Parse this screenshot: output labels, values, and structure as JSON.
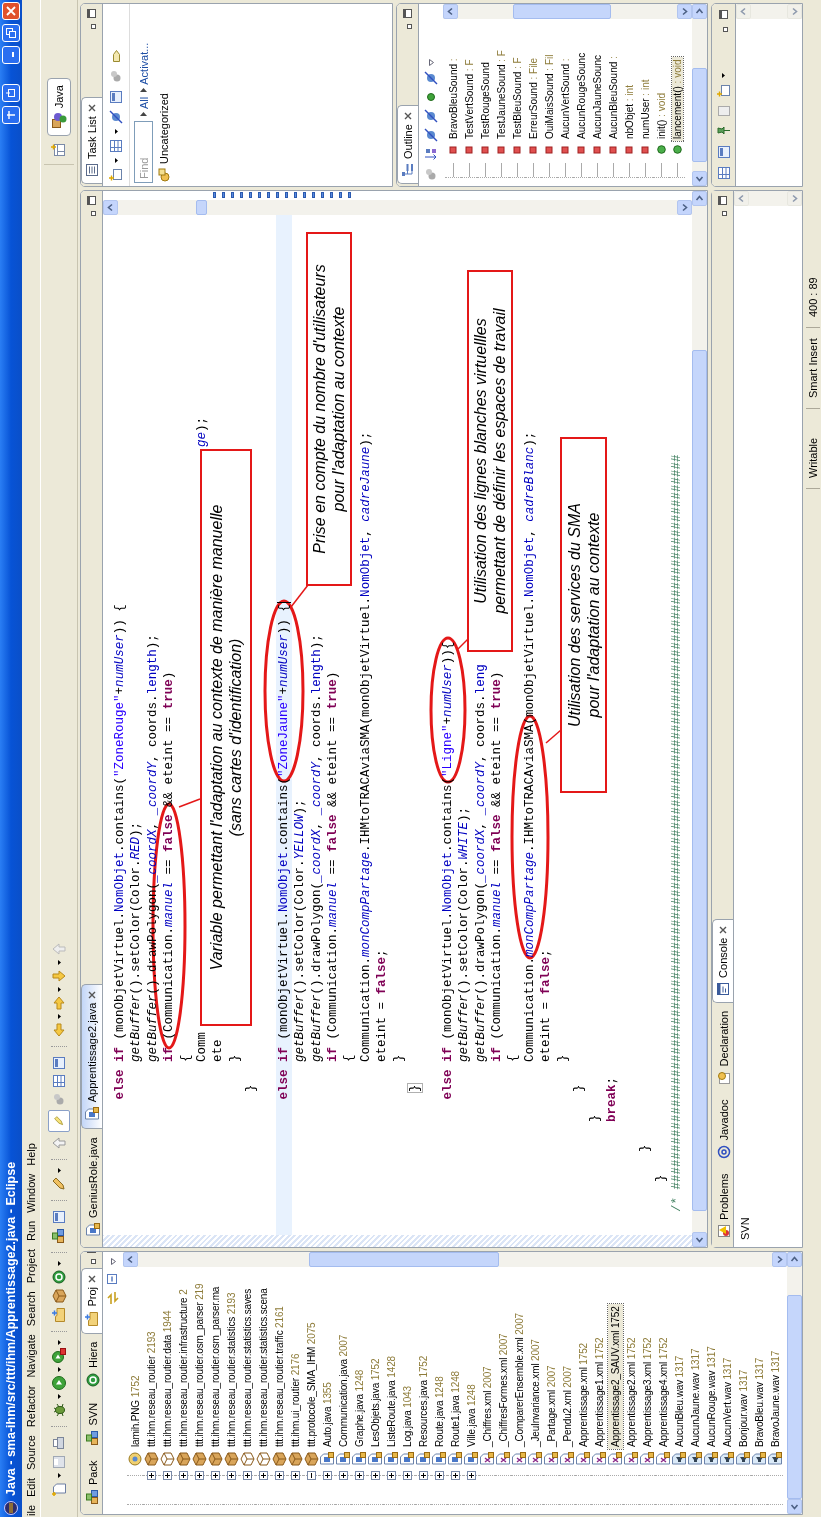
{
  "window": {
    "title": "Java - sma-ihm/src/ttt/ihm/Apprentissage2.java - Eclipse"
  },
  "menu": [
    "ile",
    "Edit",
    "Source",
    "Refactor",
    "Navigate",
    "Search",
    "Project",
    "Run",
    "Window",
    "Help"
  ],
  "perspective": {
    "label": "Java",
    "selected": true
  },
  "explorer": {
    "tabs": [
      {
        "label": "Pack",
        "selected": false
      },
      {
        "label": "SVN",
        "selected": false
      },
      {
        "label": "Hiera",
        "selected": false
      },
      {
        "label": "Proj",
        "selected": true
      }
    ],
    "items": [
      {
        "kind": "image",
        "name": "lamih.PNG",
        "rev": "1752",
        "selected": false
      },
      {
        "kind": "package",
        "name": "ttt.ihm.reseau_routier",
        "rev": "2193",
        "expanded": false,
        "selected": false
      },
      {
        "kind": "empty-package",
        "name": "ttt.ihm.reseau_routier.data",
        "rev": "1944",
        "expanded": false,
        "selected": false
      },
      {
        "kind": "package",
        "name": "ttt.ihm.reseau_routier.infrastructure",
        "rev": "2",
        "expanded": false,
        "selected": false
      },
      {
        "kind": "package",
        "name": "ttt.ihm.reseau_routier.osm_parser",
        "rev": "219",
        "expanded": false,
        "selected": false
      },
      {
        "kind": "package",
        "name": "ttt.ihm.reseau_routier.osm_parser.ma",
        "expanded": false,
        "selected": false
      },
      {
        "kind": "package",
        "name": "ttt.ihm.reseau_routier.statistics",
        "rev": "2193",
        "expanded": false,
        "selected": false
      },
      {
        "kind": "empty-package",
        "name": "ttt.ihm.reseau_routier.statistics.saves",
        "expanded": false,
        "selected": false
      },
      {
        "kind": "empty-package",
        "name": "ttt.ihm.reseau_routier.statistics.scena",
        "expanded": false,
        "selected": false
      },
      {
        "kind": "package",
        "name": "ttt.ihm.reseau_routier.traffic",
        "rev": "2161",
        "expanded": false,
        "selected": false
      },
      {
        "kind": "package",
        "name": "ttt.ihm.ui_routier",
        "rev": "2176",
        "expanded": false,
        "selected": false
      },
      {
        "kind": "package",
        "name": "ttt.protocole_SMA_IHM",
        "rev": "2075",
        "expanded": true,
        "selected": false
      },
      {
        "kind": "java",
        "name": "Auto.java",
        "rev": "1355",
        "expanded": false,
        "selected": false
      },
      {
        "kind": "java",
        "name": "Communication.java",
        "rev": "2007",
        "expanded": false,
        "selected": false
      },
      {
        "kind": "java",
        "name": "Graphe.java",
        "rev": "1248",
        "expanded": false,
        "selected": false
      },
      {
        "kind": "java",
        "name": "LesObjets.java",
        "rev": "1752",
        "expanded": false,
        "selected": false
      },
      {
        "kind": "java",
        "name": "ListeRoute.java",
        "rev": "1428",
        "expanded": false,
        "selected": false
      },
      {
        "kind": "java",
        "name": "Log.java",
        "rev": "1043",
        "expanded": false,
        "selected": false
      },
      {
        "kind": "java",
        "name": "Resources.java",
        "rev": "1752",
        "expanded": false,
        "selected": false
      },
      {
        "kind": "java",
        "name": "Route.java",
        "rev": "1248",
        "expanded": false,
        "selected": false
      },
      {
        "kind": "java",
        "name": "Route1.java",
        "rev": "1248",
        "expanded": false,
        "selected": false
      },
      {
        "kind": "java",
        "name": "Ville.java",
        "rev": "1248",
        "expanded": false,
        "selected": false
      },
      {
        "kind": "xml",
        "name": "_Chiffres.xml",
        "rev": "2007",
        "selected": false
      },
      {
        "kind": "xml",
        "name": "_ChiffresFormes.xml",
        "rev": "2007",
        "selected": false
      },
      {
        "kind": "xml",
        "name": "_ComparerEnsemble.xml",
        "rev": "2007",
        "selected": false
      },
      {
        "kind": "xml",
        "name": "_JeuInvariance.xml",
        "rev": "2007",
        "selected": false
      },
      {
        "kind": "xml",
        "name": "_Partage.xml",
        "rev": "2007",
        "selected": false
      },
      {
        "kind": "xml",
        "name": "_Pendu2.xml",
        "rev": "2007",
        "selected": false
      },
      {
        "kind": "xml",
        "name": "Apprentissage.xml",
        "rev": "1752",
        "selected": false
      },
      {
        "kind": "xml",
        "name": "Apprentissage1.xml",
        "rev": "1752",
        "selected": false
      },
      {
        "kind": "xml",
        "name": "Apprentissage2_SAUV.xml",
        "rev": "1752",
        "selected": true
      },
      {
        "kind": "xml",
        "name": "Apprentissage2.xml",
        "rev": "1752",
        "selected": false
      },
      {
        "kind": "xml",
        "name": "Apprentissage3.xml",
        "rev": "1752",
        "selected": false
      },
      {
        "kind": "xml",
        "name": "Apprentissage4.xml",
        "rev": "1752",
        "selected": false
      },
      {
        "kind": "audio",
        "name": "AucunBleu.wav",
        "rev": "1317",
        "selected": false
      },
      {
        "kind": "audio",
        "name": "AucunJaune.wav",
        "rev": "1317",
        "selected": false
      },
      {
        "kind": "audio",
        "name": "AucunRouge.wav",
        "rev": "1317",
        "selected": false
      },
      {
        "kind": "audio",
        "name": "AucunVert.wav",
        "rev": "1317",
        "selected": false
      },
      {
        "kind": "audio",
        "name": "Bonjour.wav",
        "rev": "1317",
        "selected": false
      },
      {
        "kind": "audio",
        "name": "BravoBleu.wav",
        "rev": "1317",
        "selected": false
      },
      {
        "kind": "audio",
        "name": "BravoJaune.wav",
        "rev": "1317",
        "selected": false
      }
    ]
  },
  "editor": {
    "tabs": [
      {
        "label": "GeniusRole.java",
        "selected": false
      },
      {
        "label": "Apprentissage2.java",
        "selected": true
      }
    ],
    "lines": [
      {
        "kind": "code",
        "current": false,
        "tokens": [
          {
            "kind": "keyword",
            "text": "                 else if"
          },
          {
            "kind": "plain",
            "text": " (monObjetVirtuel."
          },
          {
            "kind": "field",
            "text": "NomObjet"
          },
          {
            "kind": "plain",
            "text": ".contains("
          },
          {
            "kind": "string",
            "text": "\"ZoneRouge\""
          },
          {
            "kind": "plain",
            "text": "+"
          },
          {
            "kind": "static",
            "text": "numUser"
          },
          {
            "kind": "plain",
            "text": ")) {"
          }
        ]
      },
      {
        "kind": "code",
        "current": false,
        "tokens": [
          {
            "kind": "method",
            "text": "                      getBuffer"
          },
          {
            "kind": "plain",
            "text": "().setColor(Color."
          },
          {
            "kind": "static",
            "text": "RED"
          },
          {
            "kind": "plain",
            "text": ");"
          }
        ]
      },
      {
        "kind": "code",
        "current": false,
        "tokens": [
          {
            "kind": "method",
            "text": "                      getBuffer"
          },
          {
            "kind": "plain",
            "text": "().drawPolygon("
          },
          {
            "kind": "static",
            "text": "_coordX"
          },
          {
            "kind": "plain",
            "text": ", "
          },
          {
            "kind": "static",
            "text": "_coordY"
          },
          {
            "kind": "plain",
            "text": ", coords."
          },
          {
            "kind": "field",
            "text": "length"
          },
          {
            "kind": "plain",
            "text": ");"
          }
        ]
      },
      {
        "kind": "code",
        "current": false,
        "tokens": [
          {
            "kind": "keyword",
            "text": "                      if"
          },
          {
            "kind": "plain",
            "text": " (Communication."
          },
          {
            "kind": "static",
            "text": "manuel"
          },
          {
            "kind": "plain",
            "text": " == "
          },
          {
            "kind": "keyword",
            "text": "false"
          },
          {
            "kind": "plain",
            "text": " && eteint == "
          },
          {
            "kind": "keyword",
            "text": "true"
          },
          {
            "kind": "plain",
            "text": ")"
          }
        ]
      },
      {
        "kind": "code",
        "current": false,
        "tokens": [
          {
            "kind": "plain",
            "text": "                      {"
          }
        ]
      },
      {
        "kind": "code",
        "current": false,
        "tokens": [
          {
            "kind": "plain",
            "text": "                      Comm"
          }
        ],
        "after_cover": [
          {
            "kind": "static",
            "text": "ge"
          },
          {
            "kind": "plain",
            "text": ");"
          }
        ]
      },
      {
        "kind": "code",
        "current": false,
        "tokens": [
          {
            "kind": "plain",
            "text": "                      ete"
          }
        ]
      },
      {
        "kind": "code",
        "current": false,
        "tokens": [
          {
            "kind": "plain",
            "text": "                      }"
          }
        ]
      },
      {
        "kind": "code",
        "current": false,
        "tokens": [
          {
            "kind": "plain",
            "text": "                  }"
          }
        ]
      },
      {
        "kind": "blank",
        "current": false
      },
      {
        "kind": "code",
        "current": true,
        "tokens": [
          {
            "kind": "keyword",
            "text": "                 else if"
          },
          {
            "kind": "plain",
            "text": " (monObjetVirtuel."
          },
          {
            "kind": "field",
            "text": "NomObjet"
          },
          {
            "kind": "plain",
            "text": ".contains("
          },
          {
            "kind": "string",
            "text": "\"ZoneJaune\""
          },
          {
            "kind": "plain",
            "text": "+"
          },
          {
            "kind": "static",
            "text": "numUser"
          },
          {
            "kind": "plain",
            "text": ")) {"
          }
        ]
      },
      {
        "kind": "code",
        "current": false,
        "tokens": [
          {
            "kind": "method",
            "text": "                      getBuffer"
          },
          {
            "kind": "plain",
            "text": "().setColor(Color."
          },
          {
            "kind": "static",
            "text": "YELLOW"
          },
          {
            "kind": "plain",
            "text": ");"
          }
        ]
      },
      {
        "kind": "code",
        "current": false,
        "tokens": [
          {
            "kind": "method",
            "text": "                      getBuffer"
          },
          {
            "kind": "plain",
            "text": "().drawPolygon("
          },
          {
            "kind": "static",
            "text": "_coordX"
          },
          {
            "kind": "plain",
            "text": ", "
          },
          {
            "kind": "static",
            "text": "_coordY"
          },
          {
            "kind": "plain",
            "text": ", coords."
          },
          {
            "kind": "field",
            "text": "length"
          },
          {
            "kind": "plain",
            "text": ");"
          }
        ]
      },
      {
        "kind": "code",
        "current": false,
        "tokens": [
          {
            "kind": "keyword",
            "text": "                      if"
          },
          {
            "kind": "plain",
            "text": " (Communication."
          },
          {
            "kind": "static",
            "text": "manuel"
          },
          {
            "kind": "plain",
            "text": " == "
          },
          {
            "kind": "keyword",
            "text": "false"
          },
          {
            "kind": "plain",
            "text": " && eteint == "
          },
          {
            "kind": "keyword",
            "text": "true"
          },
          {
            "kind": "plain",
            "text": ")"
          }
        ]
      },
      {
        "kind": "code",
        "current": false,
        "tokens": [
          {
            "kind": "plain",
            "text": "                      {"
          }
        ]
      },
      {
        "kind": "code",
        "current": false,
        "tokens": [
          {
            "kind": "plain",
            "text": "                      Communication."
          },
          {
            "kind": "static",
            "text": "monCompPartage"
          },
          {
            "kind": "plain",
            "text": ".IHMtoTRACAviaSMA(monObjetVirtuel."
          },
          {
            "kind": "field",
            "text": "NomObjet"
          },
          {
            "kind": "plain",
            "text": ", "
          },
          {
            "kind": "static",
            "text": "cadreJaune"
          },
          {
            "kind": "plain",
            "text": ");"
          }
        ]
      },
      {
        "kind": "code",
        "current": false,
        "tokens": [
          {
            "kind": "plain",
            "text": "                      eteint = "
          },
          {
            "kind": "keyword",
            "text": "false"
          },
          {
            "kind": "plain",
            "text": ";"
          }
        ]
      },
      {
        "kind": "code",
        "current": false,
        "tokens": [
          {
            "kind": "plain",
            "text": "                      }"
          }
        ]
      },
      {
        "kind": "code",
        "current": false,
        "tokens": [
          {
            "kind": "bracket",
            "text": "                  }"
          }
        ]
      },
      {
        "kind": "blank",
        "current": false
      },
      {
        "kind": "code",
        "current": false,
        "tokens": [
          {
            "kind": "keyword",
            "text": "                 else if"
          },
          {
            "kind": "plain",
            "text": " (monObjetVirtuel."
          },
          {
            "kind": "field",
            "text": "NomObjet"
          },
          {
            "kind": "plain",
            "text": ".contains("
          },
          {
            "kind": "string",
            "text": "\"Ligne\""
          },
          {
            "kind": "plain",
            "text": "+"
          },
          {
            "kind": "static",
            "text": "numUser"
          },
          {
            "kind": "plain",
            "text": ")){"
          }
        ]
      },
      {
        "kind": "code",
        "current": false,
        "tokens": [
          {
            "kind": "method",
            "text": "                      getBuffer"
          },
          {
            "kind": "plain",
            "text": "().setColor(Color."
          },
          {
            "kind": "static",
            "text": "WHITE"
          },
          {
            "kind": "plain",
            "text": ");"
          }
        ]
      },
      {
        "kind": "code",
        "current": false,
        "tokens": [
          {
            "kind": "method",
            "text": "                      getBuffer"
          },
          {
            "kind": "plain",
            "text": "().drawPolygon("
          },
          {
            "kind": "static",
            "text": "_coordX"
          },
          {
            "kind": "plain",
            "text": ", "
          },
          {
            "kind": "static",
            "text": "_coordY"
          },
          {
            "kind": "plain",
            "text": ", coords."
          },
          {
            "kind": "field",
            "text": "leng"
          }
        ]
      },
      {
        "kind": "code",
        "current": false,
        "tokens": [
          {
            "kind": "keyword",
            "text": "                      if"
          },
          {
            "kind": "plain",
            "text": " (Communication."
          },
          {
            "kind": "static",
            "text": "manuel"
          },
          {
            "kind": "plain",
            "text": " == "
          },
          {
            "kind": "keyword",
            "text": "false"
          },
          {
            "kind": "plain",
            "text": " && eteint == "
          },
          {
            "kind": "keyword",
            "text": "true"
          },
          {
            "kind": "plain",
            "text": ")"
          }
        ]
      },
      {
        "kind": "code",
        "current": false,
        "tokens": [
          {
            "kind": "plain",
            "text": "                      {"
          }
        ]
      },
      {
        "kind": "code",
        "current": false,
        "tokens": [
          {
            "kind": "plain",
            "text": "                      Communication."
          },
          {
            "kind": "static",
            "text": "monCompPartage"
          },
          {
            "kind": "plain",
            "text": ".IHMtoTRACAviaSMA(monObjetVirtuel."
          },
          {
            "kind": "field",
            "text": "NomObjet"
          },
          {
            "kind": "plain",
            "text": ", "
          },
          {
            "kind": "static",
            "text": "cadreBlanc"
          },
          {
            "kind": "plain",
            "text": ");"
          }
        ]
      },
      {
        "kind": "code",
        "current": false,
        "tokens": [
          {
            "kind": "plain",
            "text": "                      eteint = "
          },
          {
            "kind": "keyword",
            "text": "false"
          },
          {
            "kind": "plain",
            "text": ";"
          }
        ]
      },
      {
        "kind": "code",
        "current": false,
        "tokens": [
          {
            "kind": "plain",
            "text": "                      }"
          }
        ]
      },
      {
        "kind": "code",
        "current": false,
        "tokens": [
          {
            "kind": "plain",
            "text": "                  }"
          }
        ]
      },
      {
        "kind": "code",
        "current": false,
        "tokens": [
          {
            "kind": "plain",
            "text": "              }"
          }
        ]
      },
      {
        "kind": "code",
        "current": false,
        "tokens": [
          {
            "kind": "keyword",
            "text": "              break"
          },
          {
            "kind": "plain",
            "text": ";"
          }
        ]
      },
      {
        "kind": "blank",
        "current": false
      },
      {
        "kind": "code",
        "current": false,
        "tokens": [
          {
            "kind": "plain",
            "text": "          }"
          }
        ]
      },
      {
        "kind": "code",
        "current": false,
        "tokens": [
          {
            "kind": "plain",
            "text": "      }"
          }
        ]
      },
      {
        "kind": "code",
        "current": false,
        "tokens": [
          {
            "kind": "comment",
            "text": "  /* ##################################################################################################"
          }
        ]
      }
    ],
    "annotations": [
      {
        "lines": [
          "Variable permettant l'adaptation au contexte de manière manuelle",
          "(sans cartes d'identification)"
        ]
      },
      {
        "lines": [
          "Prise en compte du nombre d'utilisateurs",
          "pour l'adaptation au contexte"
        ]
      },
      {
        "lines": [
          "Utilisation des lignes blanches virtuellles",
          "permettant de définir les espaces de travail"
        ]
      },
      {
        "lines": [
          "Utilisation des services du SMA",
          "pour l'adaptation au contexte"
        ]
      }
    ]
  },
  "bottom_panel": {
    "tabs": [
      {
        "label": "Problems",
        "selected": false
      },
      {
        "label": "Javadoc",
        "selected": false
      },
      {
        "label": "Declaration",
        "selected": false
      },
      {
        "label": "Console",
        "selected": true
      }
    ],
    "content": "SVN"
  },
  "task_list": {
    "tab": {
      "label": "Task List",
      "selected": true
    },
    "find": {
      "placeholder": "Find"
    },
    "filters": [
      "All",
      "Activat..."
    ],
    "category": "Uncategorized"
  },
  "outline": {
    "tab": {
      "label": "Outline",
      "selected": true
    },
    "items": [
      {
        "kind": "field",
        "name": "BravoBleuSound",
        "type": ":",
        "selected": false
      },
      {
        "kind": "field",
        "name": "TestVertSound",
        "type": ": F",
        "selected": false
      },
      {
        "kind": "field",
        "name": "TestRougeSound",
        "selected": false
      },
      {
        "kind": "field",
        "name": "TestJauneSound",
        "type": ": F",
        "selected": false
      },
      {
        "kind": "field",
        "name": "TestBleuSound",
        "type": ": F",
        "selected": false
      },
      {
        "kind": "field",
        "name": "ErreurSound",
        "type": ": File",
        "selected": false
      },
      {
        "kind": "field",
        "name": "OuiMaisSound",
        "type": ": Fil",
        "selected": false
      },
      {
        "kind": "field",
        "name": "AucunVertSound",
        "type": ":",
        "selected": false
      },
      {
        "kind": "field",
        "name": "AucunRougeSounc",
        "selected": false
      },
      {
        "kind": "field",
        "name": "AucunJauneSounc",
        "selected": false
      },
      {
        "kind": "field",
        "name": "AucunBleuSound",
        "type": ":",
        "selected": false
      },
      {
        "kind": "field",
        "name": "nbObjet",
        "type": ": int",
        "selected": false
      },
      {
        "kind": "field",
        "name": "numUser",
        "type": ": int",
        "selected": false
      },
      {
        "kind": "method",
        "name": "init()",
        "type": ": void",
        "selected": false
      },
      {
        "kind": "method",
        "name": "lancement()",
        "type": ": void",
        "selected": true
      }
    ]
  },
  "status_bar": [
    "Writable",
    "Smart Insert",
    "400 : 89"
  ]
}
